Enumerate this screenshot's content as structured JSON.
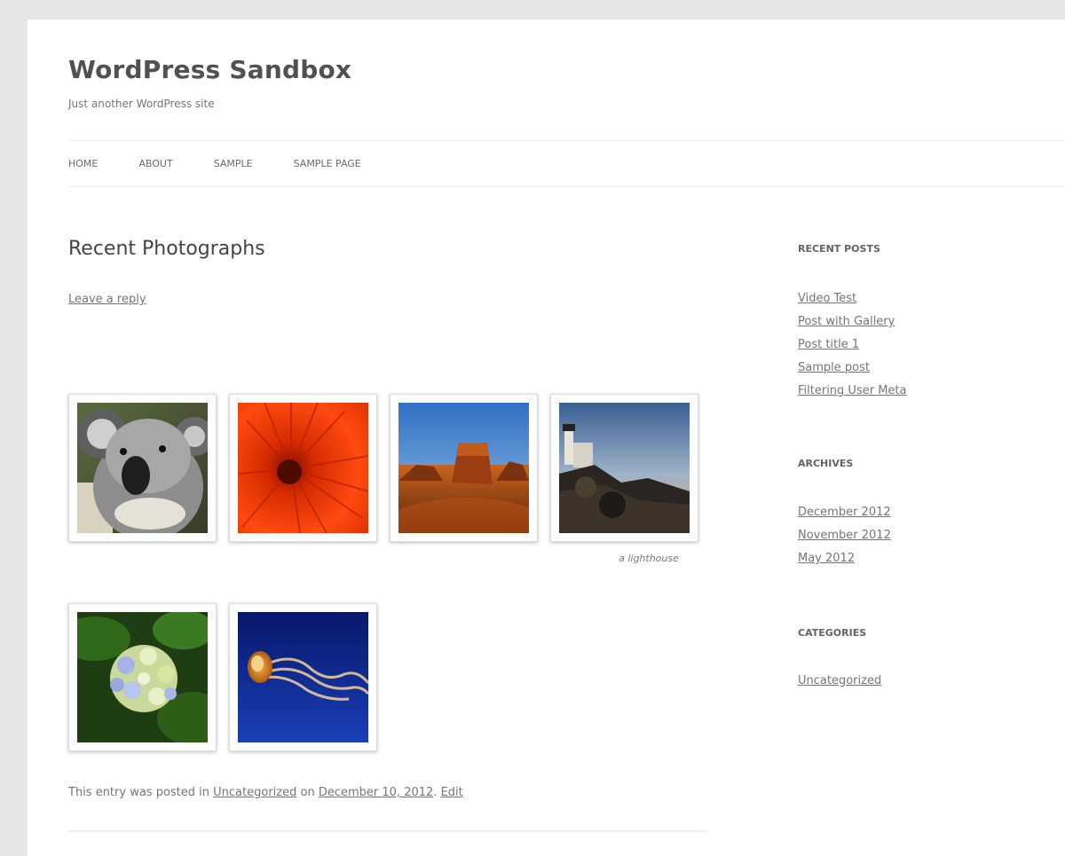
{
  "site": {
    "title": "WordPress Sandbox",
    "description": "Just another WordPress site"
  },
  "nav": {
    "items": [
      {
        "label": "HOME"
      },
      {
        "label": "ABOUT"
      },
      {
        "label": "SAMPLE"
      },
      {
        "label": "SAMPLE PAGE"
      }
    ]
  },
  "post": {
    "title": "Recent Photographs",
    "leave_reply": "Leave a reply",
    "gallery": {
      "images": [
        {
          "subject": "koala"
        },
        {
          "subject": "orange-flower"
        },
        {
          "subject": "desert-mesa"
        },
        {
          "subject": "lighthouse",
          "caption": "a lighthouse"
        },
        {
          "subject": "hydrangea"
        },
        {
          "subject": "jellyfish"
        }
      ]
    },
    "meta": {
      "prefix": "This entry was posted in",
      "category": "Uncategorized",
      "on": "on",
      "date": "December 10, 2012",
      "sep": ".",
      "edit": "Edit"
    }
  },
  "sidebar": {
    "recent_posts": {
      "title": "RECENT POSTS",
      "items": [
        "Video Test",
        "Post with Gallery",
        "Post title 1",
        "Sample post",
        "Filtering User Meta"
      ]
    },
    "archives": {
      "title": "ARCHIVES",
      "items": [
        "December 2012",
        "November 2012",
        "May 2012"
      ]
    },
    "categories": {
      "title": "CATEGORIES",
      "items": [
        "Uncategorized"
      ]
    }
  }
}
